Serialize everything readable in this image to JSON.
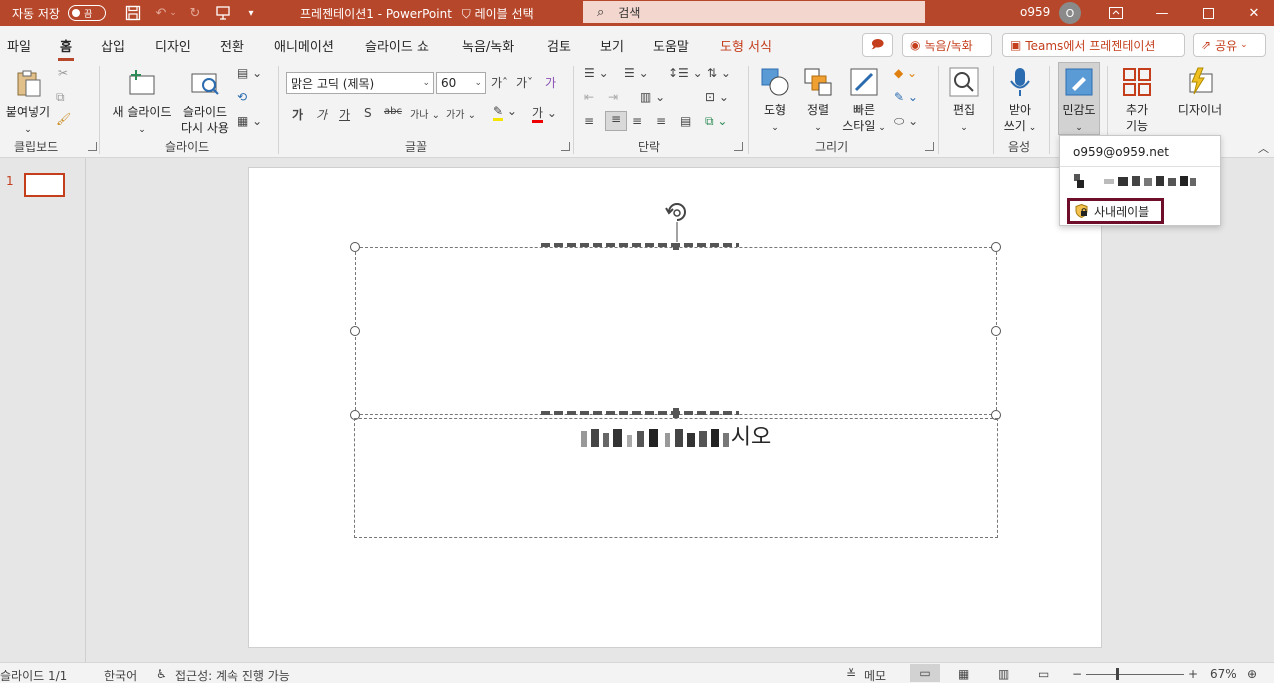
{
  "titlebar": {
    "autosave_label": "자동 저장",
    "autosave_state": "끔",
    "doc_title": "프레젠테이션1  -  PowerPoint",
    "label_select": "레이블 선택",
    "search_placeholder": "검색",
    "user_name": "o959",
    "avatar_initial": "O"
  },
  "tabs": {
    "file": "파일",
    "home": "홈",
    "insert": "삽입",
    "design": "디자인",
    "transitions": "전환",
    "animations": "애니메이션",
    "slideshow": "슬라이드 쇼",
    "record": "녹음/녹화",
    "review": "검토",
    "view": "보기",
    "help": "도움말",
    "shape_format": "도형 서식"
  },
  "topright": {
    "record_btn": "녹음/녹화",
    "teams_btn": "Teams에서 프레젠테이션",
    "share_btn": "공유"
  },
  "ribbon": {
    "paste": "붙여넣기",
    "clipboard": "클립보드",
    "new_slide": "새 슬라이드",
    "reuse_slides_1": "슬라이드",
    "reuse_slides_2": "다시 사용",
    "slides": "슬라이드",
    "font_name": "맑은 고딕 (제목)",
    "font_size": "60",
    "font": "글꼴",
    "paragraph": "단락",
    "shapes": "도형",
    "arrange": "정렬",
    "quick_styles_1": "빠른",
    "quick_styles_2": "스타일",
    "drawing": "그리기",
    "editing": "편집",
    "dictate_1": "받아",
    "dictate_2": "쓰기",
    "voice": "음성",
    "sensitivity": "민감도",
    "addins_1": "추가",
    "addins_2": "기능",
    "designer": "디자이너"
  },
  "thumbnail": {
    "number": "1"
  },
  "slide": {
    "subtitle_suffix": "시오"
  },
  "sensitivity_menu": {
    "email": "o959@o959.net",
    "label": "사내레이블"
  },
  "statusbar": {
    "slide_count": "슬라이드 1/1",
    "language": "한국어",
    "accessibility": "접근성: 계속 진행 가능",
    "notes": "메모",
    "zoom": "67%"
  },
  "colors": {
    "accent": "#b7472a",
    "contextual_tab": "#c43e1c",
    "label_border": "#6e0e2a"
  }
}
